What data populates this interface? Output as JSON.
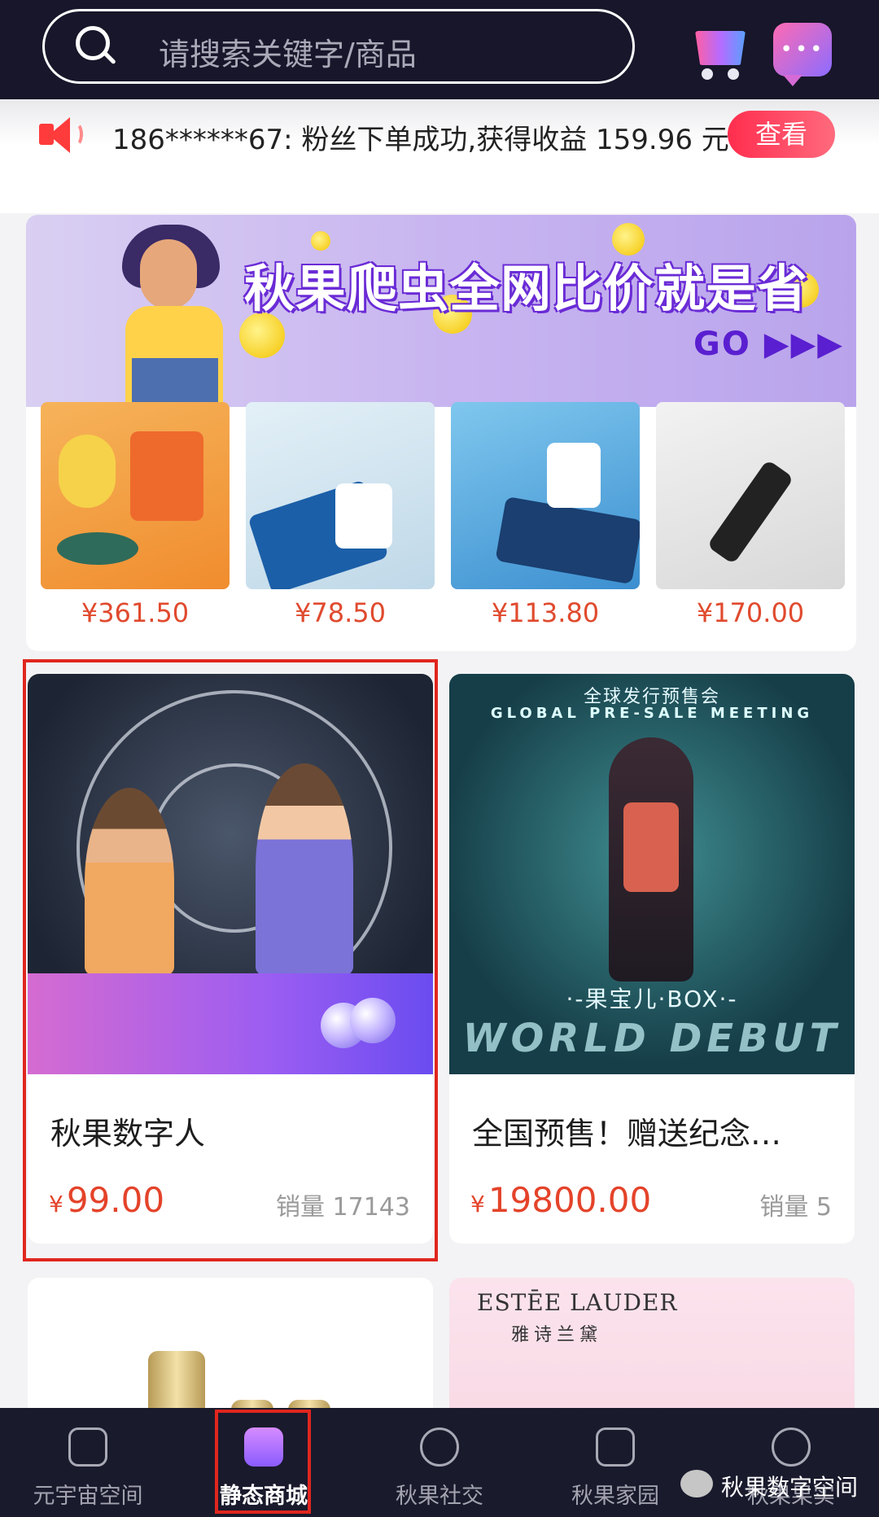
{
  "search": {
    "placeholder": "请搜索关键字/商品"
  },
  "header_icons": {
    "cart": "cart-icon",
    "message": "message-icon"
  },
  "notice": {
    "text": "186******67: 粉丝下单成功,获得收益 159.96 元",
    "button_label": "查看",
    "accent_color": "#ff2d4e"
  },
  "banner": {
    "slogan": "秋果爬虫全网比价就是省",
    "cta": "GO ▶▶▶"
  },
  "mini_products": [
    {
      "price": "¥361.50"
    },
    {
      "price": "¥78.50"
    },
    {
      "price": "¥113.80"
    },
    {
      "price": "¥170.00"
    }
  ],
  "products": [
    {
      "name": "秋果数字人",
      "price_symbol": "¥",
      "price": "99.00",
      "sales": "销量 17143"
    },
    {
      "name": "全国预售！赠送纪念…",
      "price_symbol": "¥",
      "price": "19800.00",
      "sales": "销量 5",
      "image_text": {
        "top": "全球发行预售会",
        "top_en": "GLOBAL PRE-SALE MEETING",
        "title": "·-果宝儿·BOX·-",
        "debut": "WORLD DEBUT"
      }
    }
  ],
  "partial_products": {
    "brand": "ESTĒE LAUDER",
    "brand_cn": "雅诗兰黛"
  },
  "tabs": [
    {
      "label": "元宇宙空间",
      "icon": "cube-icon"
    },
    {
      "label": "静态商城",
      "icon": "store-icon",
      "active": true
    },
    {
      "label": "秋果社交",
      "icon": "social-icon"
    },
    {
      "label": "秋果家园",
      "icon": "home-icon"
    },
    {
      "label": "秋果果实",
      "icon": "profile-icon"
    }
  ],
  "watermark": {
    "text": "秋果数字空间"
  },
  "colors": {
    "topbar": "#17162a",
    "price": "#e4432a",
    "highlight": "#e0261e"
  }
}
